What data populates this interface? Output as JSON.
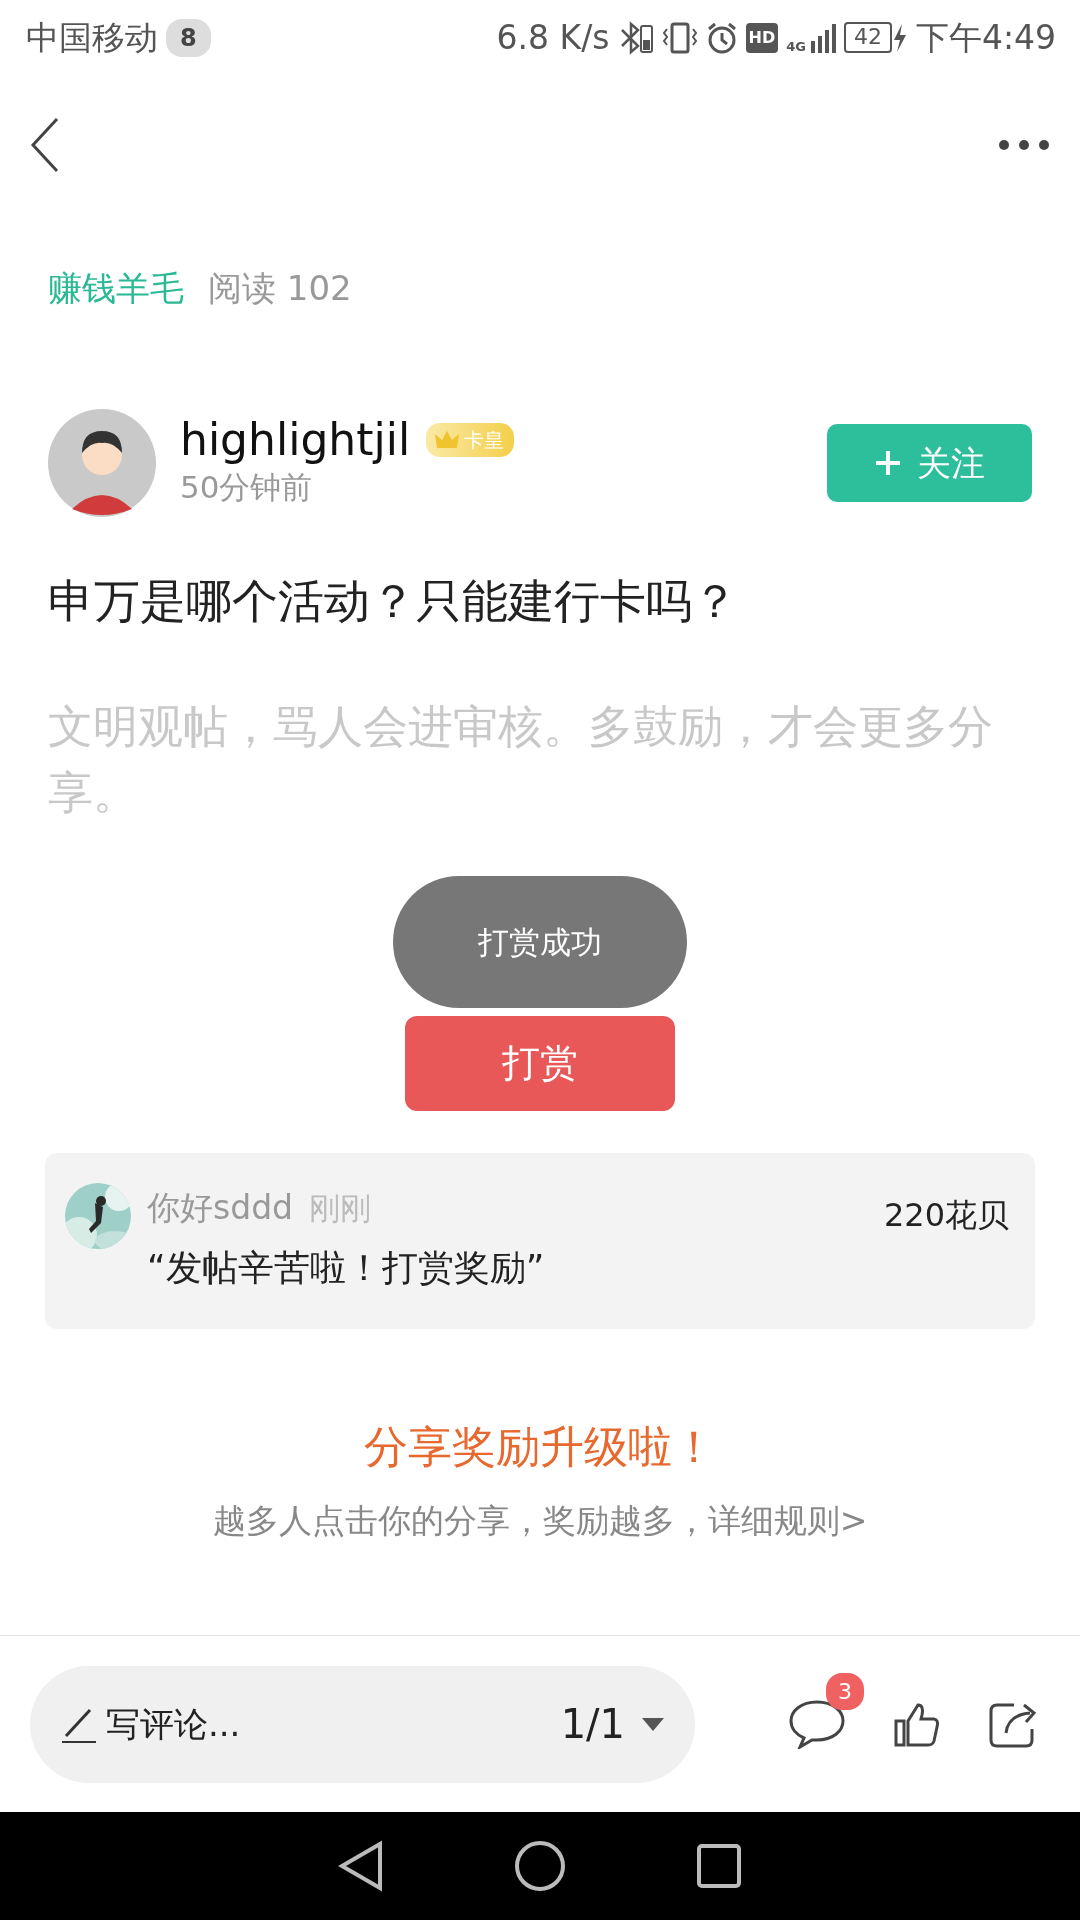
{
  "status_bar": {
    "carrier": "中国移动",
    "notification_count": "8",
    "speed": "6.8 K/s",
    "hd": "HD",
    "network": "4G",
    "battery": "42",
    "time": "下午4:49"
  },
  "post": {
    "category": "赚钱羊毛",
    "reads": "阅读 102",
    "author": "highlightjil",
    "author_badge": "卡皇",
    "posted": "50分钟前",
    "follow_button": "关注",
    "title": "申万是哪个活动？只能建行卡吗？",
    "body_placeholder": "文明观帖，骂人会进审核。多鼓励，才会更多分享。"
  },
  "toast": "打赏成功",
  "reward_button": "打赏",
  "rewards": [
    {
      "user": "你好sddd",
      "time": "刚刚",
      "message": "“发帖辛苦啦！打赏奖励”",
      "amount": "220花贝"
    }
  ],
  "share_promo": {
    "title": "分享奖励升级啦！",
    "text": "越多人点击你的分享，奖励越多，详细规则>"
  },
  "bottom_bar": {
    "comment_placeholder": "写评论...",
    "page": "1/1",
    "comment_count": "3"
  }
}
